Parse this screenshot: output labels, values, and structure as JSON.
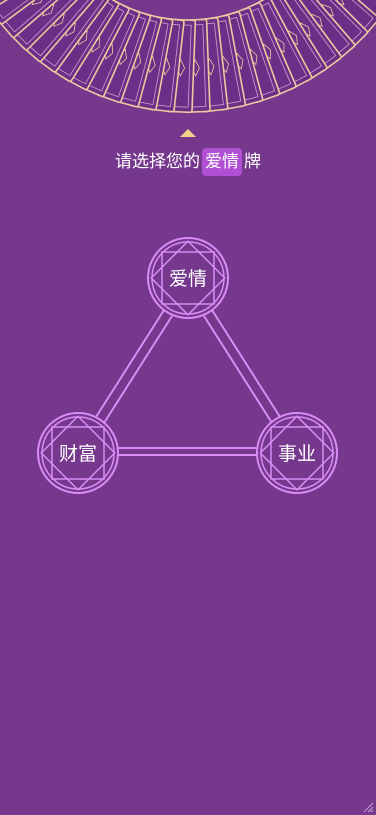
{
  "prompt": {
    "prefix": "请选择您的",
    "selected": "爱情",
    "suffix": "牌"
  },
  "spread": {
    "nodes": [
      {
        "key": "love",
        "label": "爱情"
      },
      {
        "key": "wealth",
        "label": "财富"
      },
      {
        "key": "career",
        "label": "事业"
      }
    ]
  },
  "colors": {
    "background": "#75388d",
    "accent": "#d98cf5",
    "highlight": "#b04fd3",
    "gold": "#f4d38a"
  }
}
